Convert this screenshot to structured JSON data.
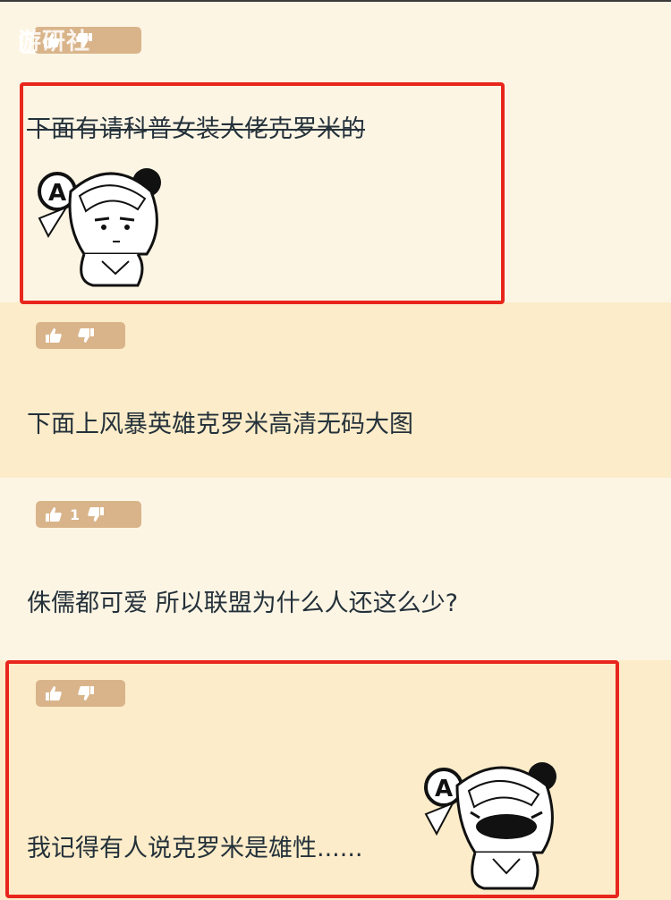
{
  "comments": [
    {
      "text": "下面有请科普女装大佬克罗米的",
      "likes": "",
      "strikethrough": true,
      "sticker": "anime-girl-sticker",
      "highlighted": true
    },
    {
      "text": "下面上风暴英雄克罗米高清无码大图",
      "likes": "",
      "strikethrough": false,
      "sticker": "",
      "highlighted": false
    },
    {
      "text": "侏儒都可爱 所以联盟为什么人还这么少?",
      "likes": "1",
      "strikethrough": false,
      "sticker": "",
      "highlighted": false
    },
    {
      "text": "我记得有人说克罗米是雄性......",
      "likes": "",
      "strikethrough": false,
      "sticker": "anime-girl-blushing-sticker",
      "highlighted": true
    }
  ],
  "watermark": "游研社",
  "colors": {
    "background": "#fdf5e4",
    "alt_background": "#fcecc9",
    "vote_bar": "#d9b48a",
    "highlight": "#e8261c",
    "text": "#24313a"
  },
  "icons": {
    "like": "thumbs-up-icon",
    "dislike": "thumbs-down-icon"
  }
}
